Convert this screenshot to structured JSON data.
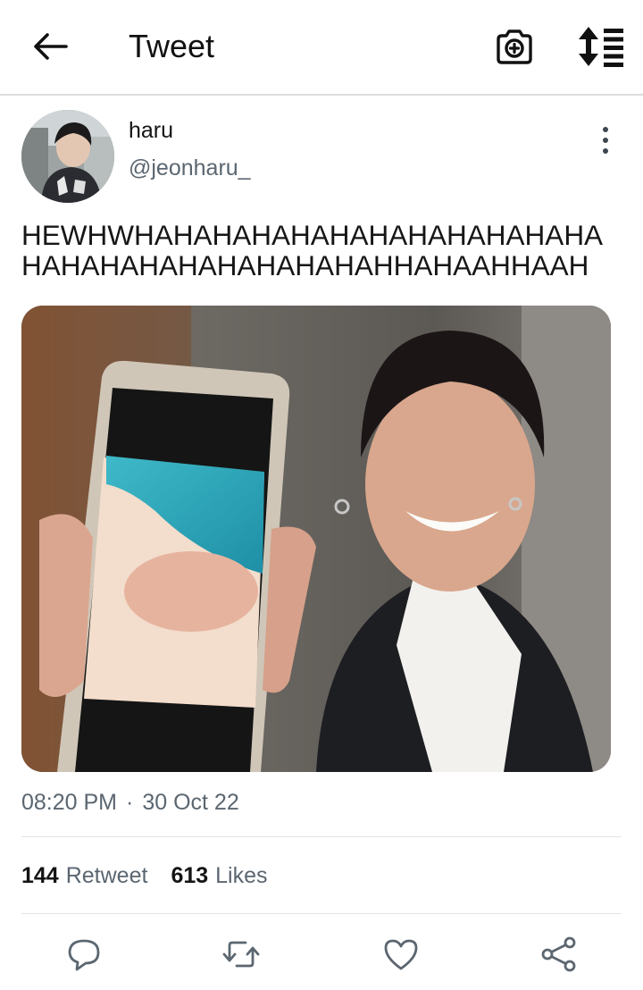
{
  "header": {
    "title": "Tweet",
    "back_icon": "arrow-left-icon",
    "camera_icon": "camera-plus-icon",
    "sort_icon": "sort-list-icon"
  },
  "tweet": {
    "author_name": "haru",
    "author_handle": "@jeonharu_",
    "text": "HEWHWHAHAHAHAHAHAHAHAHAHAHAHAHAHAHAHAHAHAHAHAHAHHAHAAHHAAH",
    "time": "08:20 PM",
    "separator": "·",
    "date": "30 Oct 22",
    "retweets_count": "144",
    "retweets_label": "Retweet",
    "likes_count": "613",
    "likes_label": "Likes"
  },
  "actions": [
    {
      "icon": "reply-icon"
    },
    {
      "icon": "retweet-icon"
    },
    {
      "icon": "heart-icon"
    },
    {
      "icon": "share-icon"
    }
  ],
  "colors": {
    "text_primary": "#141414",
    "text_secondary": "#5b6670",
    "divider": "#e1e4e7",
    "icon": "#5b6670"
  }
}
